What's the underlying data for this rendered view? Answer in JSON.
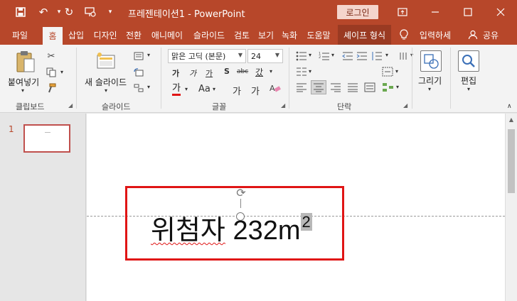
{
  "titlebar": {
    "title": "프레젠테이션1  -  PowerPoint",
    "login": "로그인",
    "qat_icons": [
      "save-icon",
      "undo-icon",
      "redo-icon",
      "present-icon",
      "customize-icon"
    ]
  },
  "tabs": {
    "items": [
      "파일",
      "홈",
      "삽입",
      "디자인",
      "전환",
      "애니메이",
      "슬라이드",
      "검토",
      "보기",
      "녹화",
      "도움말",
      "셰이프 형식"
    ],
    "active": "홈",
    "tellme": "입력하세",
    "share": "공유"
  },
  "ribbon": {
    "clipboard": {
      "paste": "붙여넣기",
      "label": "클립보드"
    },
    "slides": {
      "new_slide": "새 슬라이드",
      "label": "슬라이드"
    },
    "font": {
      "font_name": "맑은 고딕 (본문)",
      "font_size": "24",
      "row1": [
        "가",
        "가",
        "가",
        "S",
        "abc",
        "갔"
      ],
      "row2": [
        "가",
        "Aa",
        "가",
        "가"
      ],
      "label": "글꼴"
    },
    "paragraph": {
      "label": "단락"
    },
    "drawing": {
      "label": "그리기"
    },
    "editing": {
      "label": "편집"
    }
  },
  "thumbnails": {
    "slide_number": "1"
  },
  "slide": {
    "text_main": "위첨자",
    "text_rest": " 232m",
    "superscript": "2"
  }
}
